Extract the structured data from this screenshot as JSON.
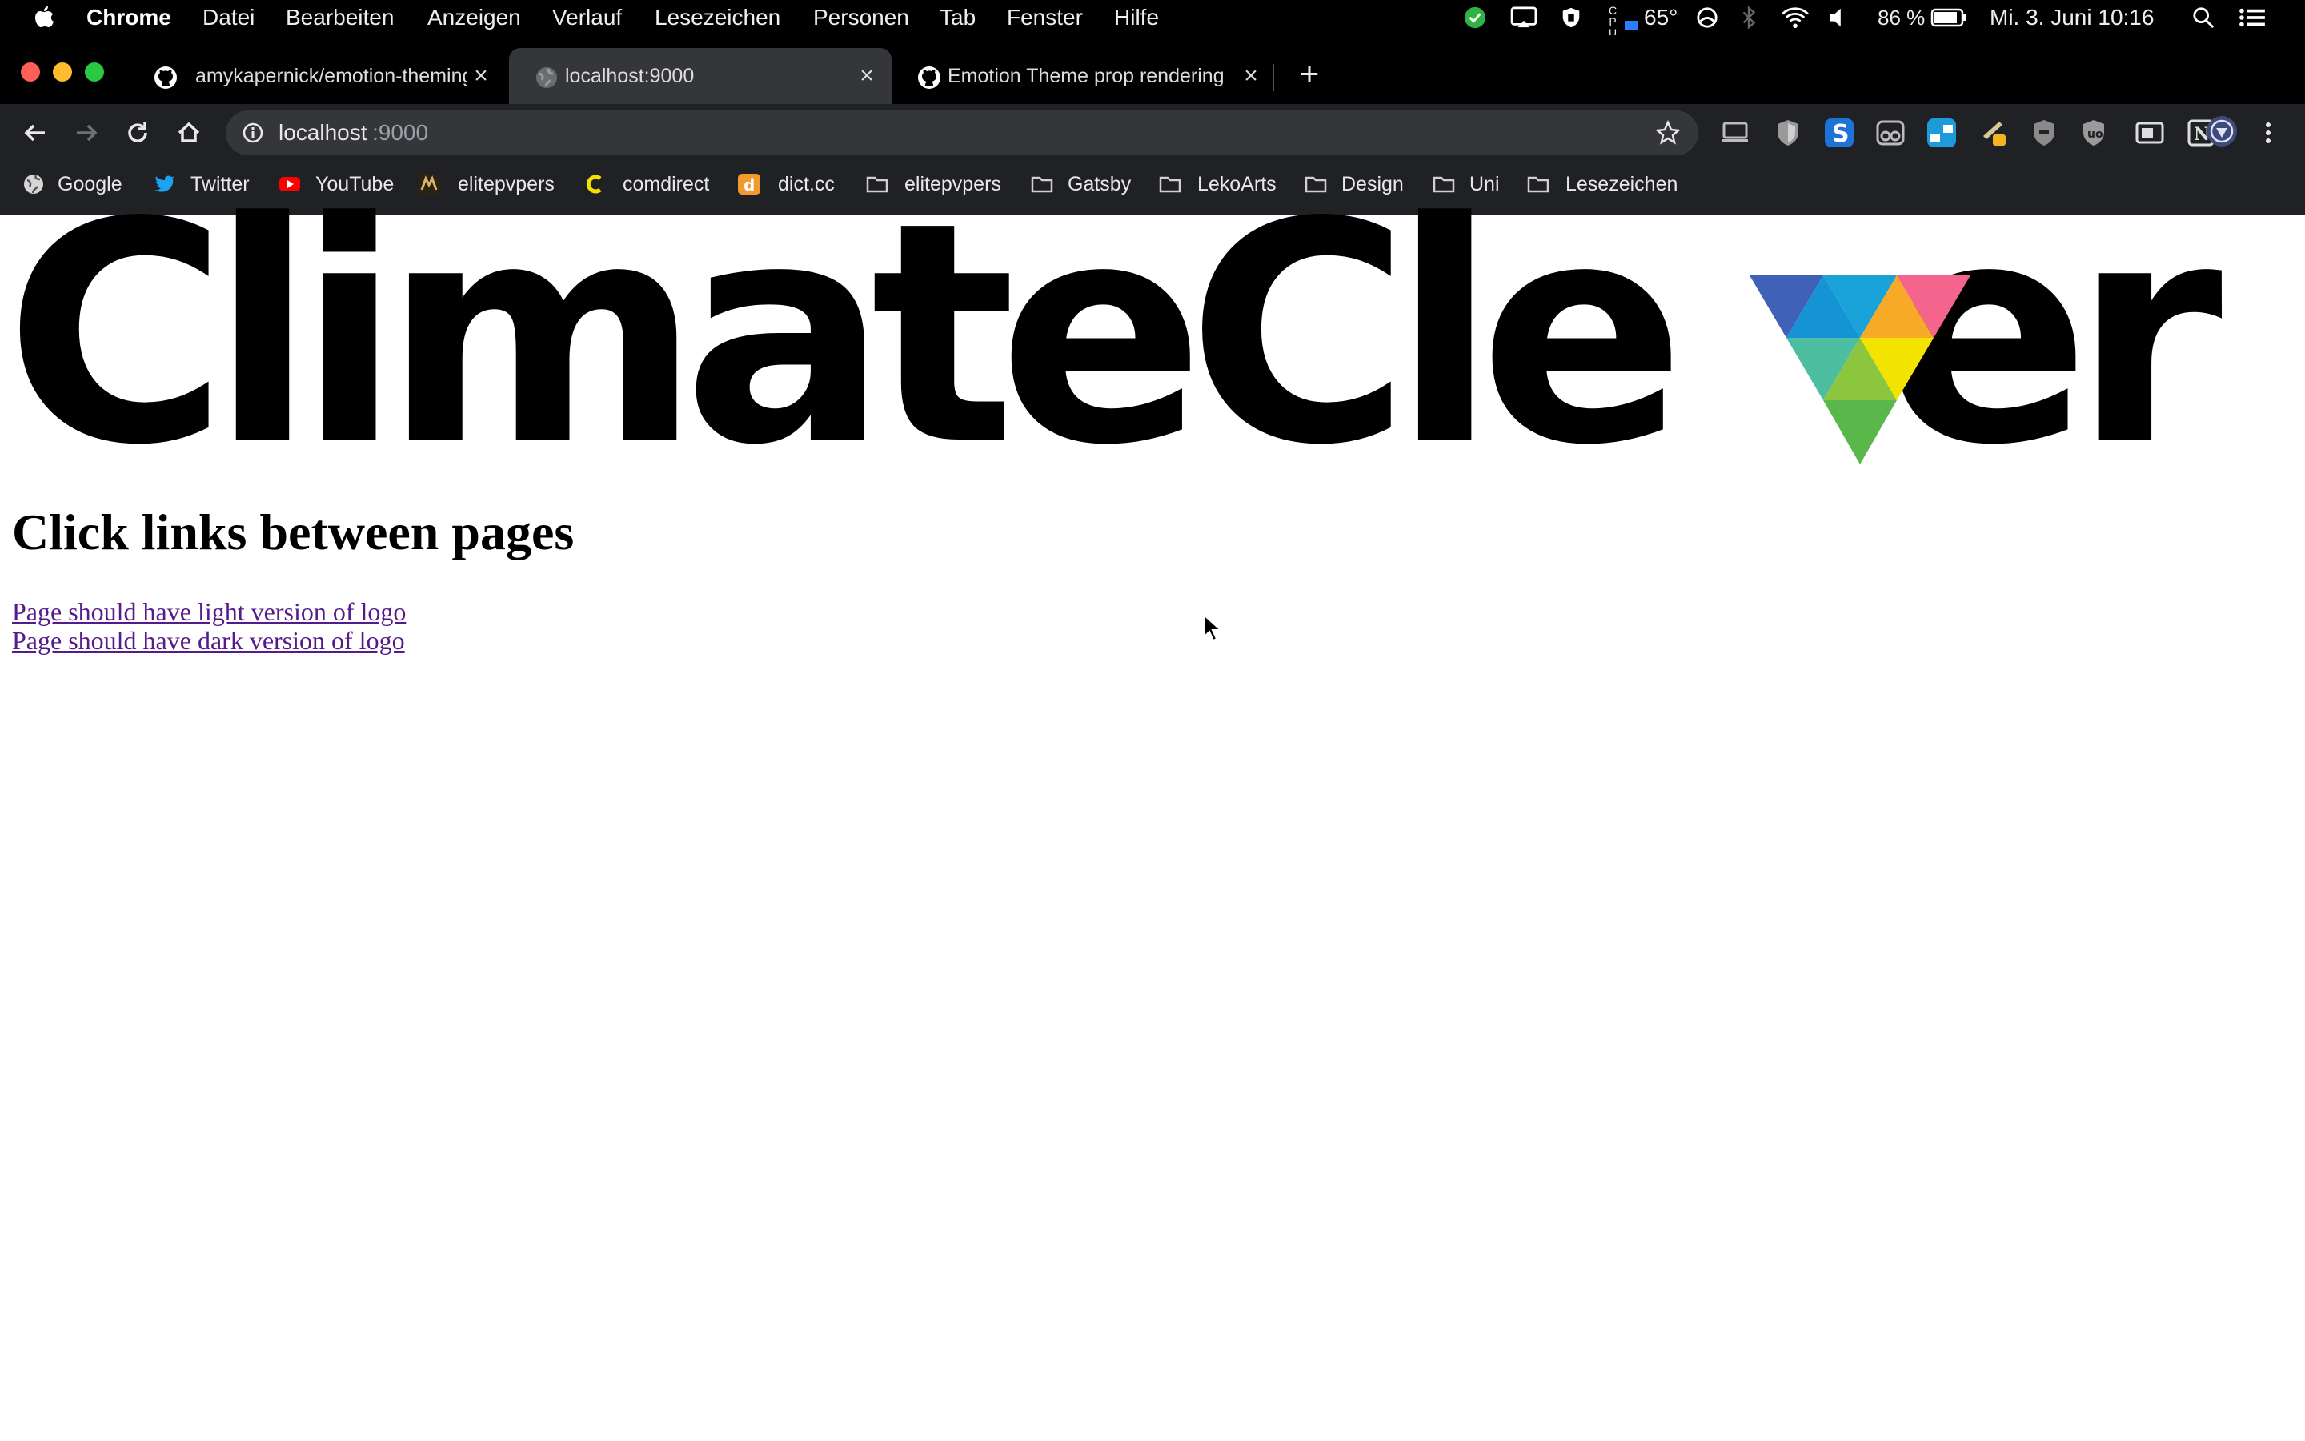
{
  "menubar": {
    "app_name": "Chrome",
    "items": [
      "Datei",
      "Bearbeiten",
      "Anzeigen",
      "Verlauf",
      "Lesezeichen",
      "Personen",
      "Tab",
      "Fenster",
      "Hilfe"
    ],
    "cpu_temp": "65°",
    "battery": "86 %",
    "clock": "Mi. 3. Juni 10:16"
  },
  "tabs": [
    {
      "title": "amykapernick/emotion-theming",
      "icon": "github-icon",
      "active": false
    },
    {
      "title": "localhost:9000",
      "icon": "globe-icon",
      "active": true
    },
    {
      "title": "Emotion Theme prop rendering",
      "icon": "github-icon",
      "active": false
    }
  ],
  "address_bar": {
    "host": "localhost",
    "port": ":9000"
  },
  "bookmarks": [
    {
      "label": "Google",
      "icon": "globe-icon"
    },
    {
      "label": "Twitter",
      "icon": "twitter-icon"
    },
    {
      "label": "YouTube",
      "icon": "youtube-icon"
    },
    {
      "label": "elitepvpers",
      "icon": "elitepvpers-icon"
    },
    {
      "label": "comdirect",
      "icon": "comdirect-icon"
    },
    {
      "label": "dict.cc",
      "icon": "dictcc-icon"
    },
    {
      "label": "elitepvpers",
      "icon": "folder-icon"
    },
    {
      "label": "Gatsby",
      "icon": "folder-icon"
    },
    {
      "label": "LekoArts",
      "icon": "folder-icon"
    },
    {
      "label": "Design",
      "icon": "folder-icon"
    },
    {
      "label": "Uni",
      "icon": "folder-icon"
    },
    {
      "label": "Lesezeichen",
      "icon": "folder-icon"
    }
  ],
  "page": {
    "logo_text": "ClimateCle",
    "logo_tail": "er",
    "heading": "Click links between pages",
    "links": [
      "Page should have light version of logo",
      "Page should have dark version of logo"
    ]
  },
  "colors": {
    "link_visited": "#551a8b",
    "tab_active": "#35363a",
    "toolbar": "#202124"
  }
}
